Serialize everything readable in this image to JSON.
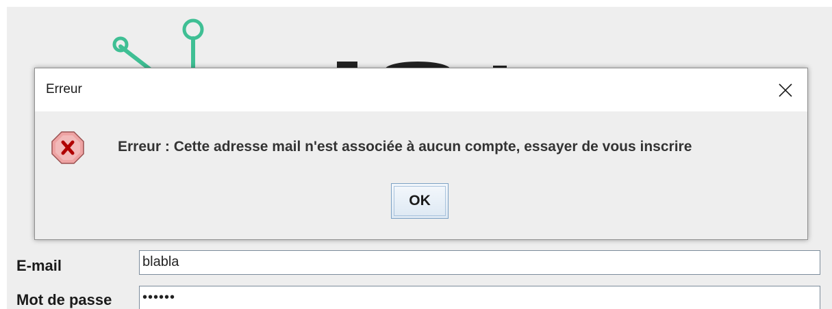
{
  "dialog": {
    "title": "Erreur",
    "message": "Erreur : Cette adresse mail n'est associée à aucun compte, essayer de vous inscrire",
    "ok_label": "OK",
    "close_icon": "close-icon",
    "status_icon": "error-icon"
  },
  "form": {
    "email_label": "E-mail",
    "email_value": "blabla",
    "password_label": "Mot de passe",
    "password_value": "••••••"
  },
  "colors": {
    "logo_accent": "#3fbf94",
    "logo_dark": "#222222",
    "error_icon_fill": "#eea3a3",
    "error_icon_mark": "#b00000",
    "button_border": "#7aa0c4",
    "window_background": "#eeeeee"
  }
}
